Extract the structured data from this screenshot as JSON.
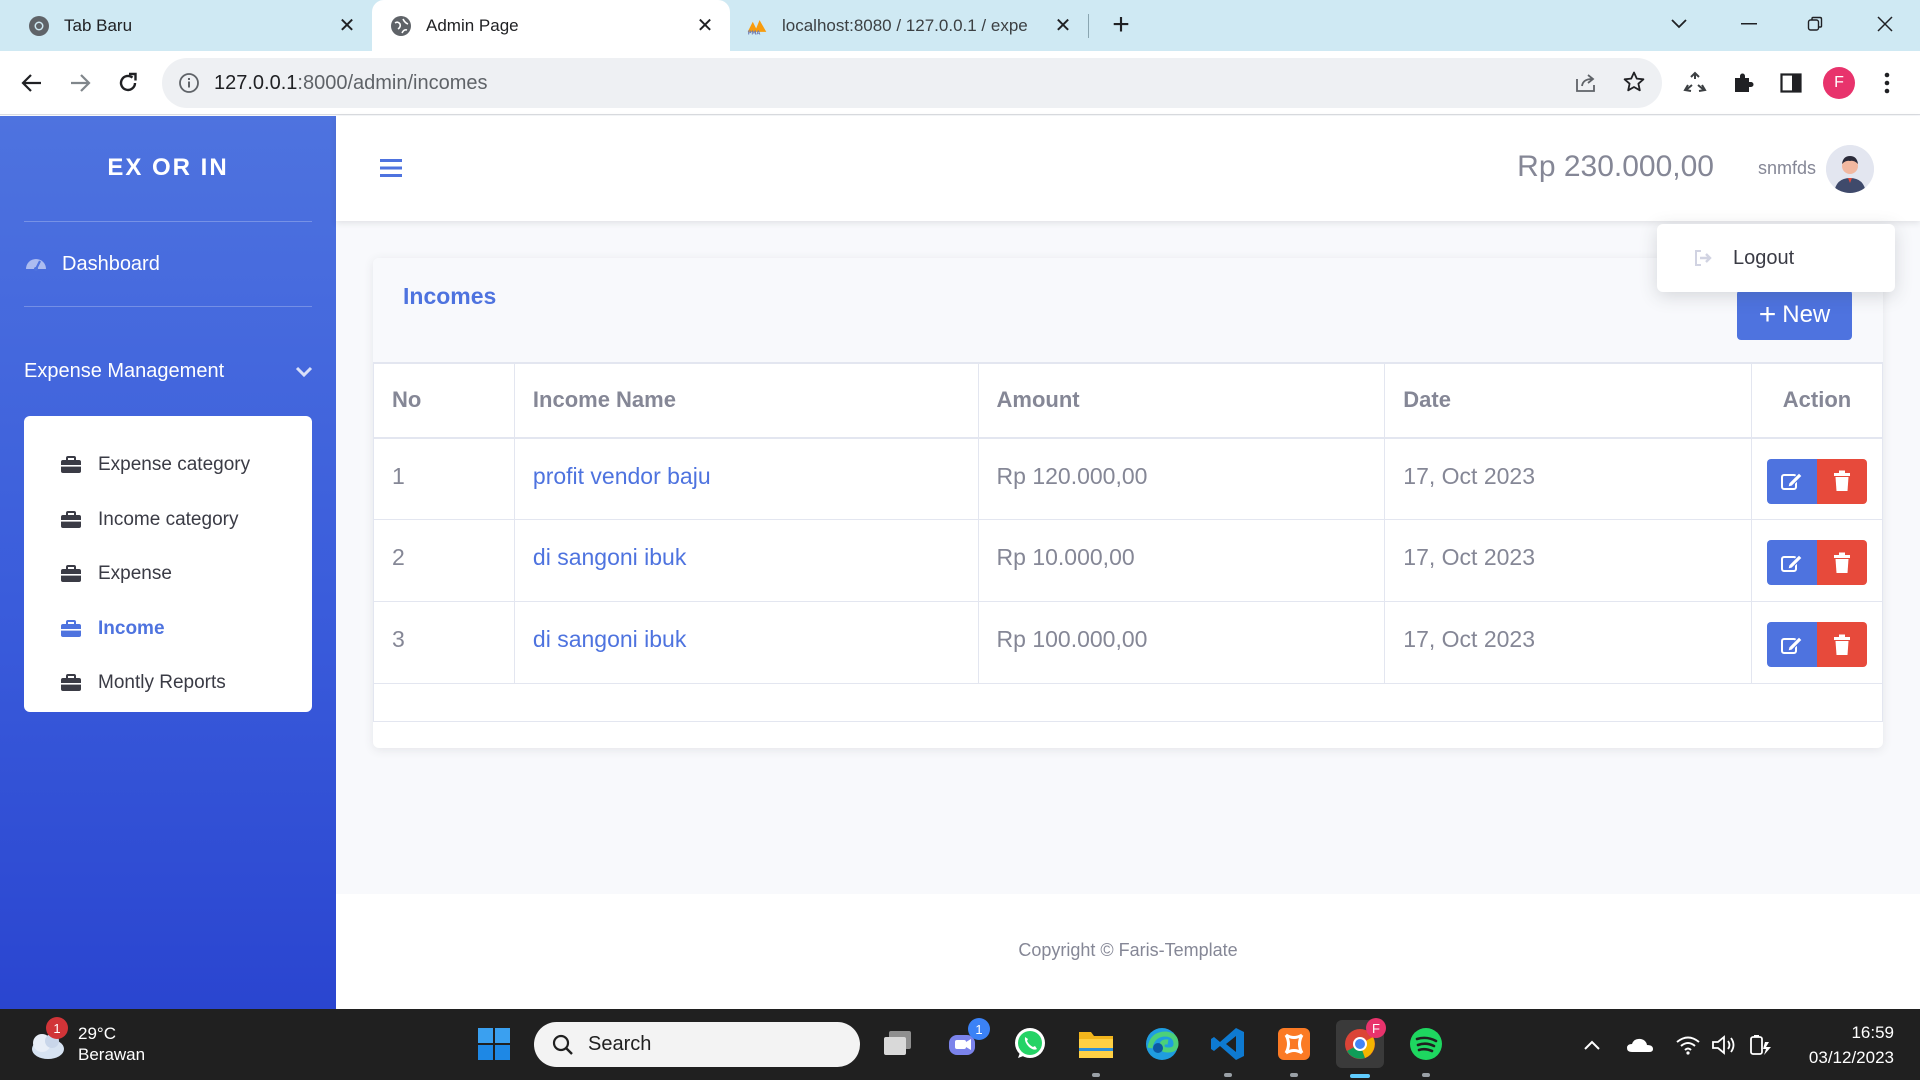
{
  "browser": {
    "tabs": [
      {
        "label": "Tab Baru",
        "icon": "chrome-icon"
      },
      {
        "label": "Admin Page",
        "icon": "globe-icon"
      },
      {
        "label": "localhost:8080 / 127.0.0.1 / expe",
        "icon": "phpmyadmin-icon"
      }
    ],
    "url_host": "127.0.0.1",
    "url_rest": ":8000/admin/incomes",
    "profile_initial": "F"
  },
  "sidebar": {
    "brand": "EX OR IN",
    "dashboard": "Dashboard",
    "group": "Expense Management",
    "items": [
      {
        "label": "Expense category",
        "active": false
      },
      {
        "label": "Income category",
        "active": false
      },
      {
        "label": "Expense",
        "active": false
      },
      {
        "label": "Income",
        "active": true
      },
      {
        "label": "Montly Reports",
        "active": false
      }
    ]
  },
  "topbar": {
    "balance": "Rp 230.000,00",
    "username": "snmfds"
  },
  "dropdown": {
    "logout": "Logout"
  },
  "card": {
    "title": "Incomes",
    "new_label": "New",
    "columns": [
      "No",
      "Income Name",
      "Amount",
      "Date",
      "Action"
    ],
    "rows": [
      {
        "no": "1",
        "name": "profit vendor baju",
        "amount": "Rp 120.000,00",
        "date": "17, Oct 2023"
      },
      {
        "no": "2",
        "name": "di sangoni ibuk",
        "amount": "Rp 10.000,00",
        "date": "17, Oct 2023"
      },
      {
        "no": "3",
        "name": "di sangoni ibuk",
        "amount": "Rp 100.000,00",
        "date": "17, Oct 2023"
      }
    ]
  },
  "footer": {
    "copyright": "Copyright © Faris-Template"
  },
  "taskbar": {
    "temp": "29°C",
    "weather": "Berawan",
    "weather_badge": "1",
    "search_placeholder": "Search",
    "teams_badge": "1",
    "time": "16:59",
    "date": "03/12/2023"
  },
  "colors": {
    "primary": "#4e73df",
    "danger": "#e74a3b",
    "muted_text": "#858796"
  }
}
